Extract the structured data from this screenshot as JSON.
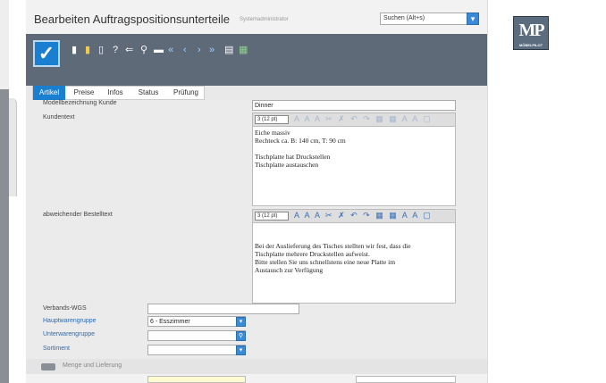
{
  "window": {
    "title": "Bearbeiten Auftragspositionsunterteile",
    "user": "Systemadministrator"
  },
  "search": {
    "placeholder": "Suchen (Alt+s)"
  },
  "logo": {
    "text": "MP",
    "tagline": "MÖBELPILOT"
  },
  "toolbar": {
    "icons": [
      "confirm-icon",
      "new-document-icon",
      "highlight-icon",
      "delete-icon",
      "help-icon",
      "back-icon",
      "search-icon",
      "print-icon",
      "first-icon",
      "previous-icon",
      "next-icon",
      "last-icon",
      "edit-document-icon",
      "table-icon"
    ],
    "glyphs": {
      "help": "?",
      "back": "⇐",
      "first": "«",
      "previous": "‹",
      "next": "›",
      "last": "»"
    }
  },
  "tabs": [
    {
      "label": "Artikel",
      "active": true
    },
    {
      "label": "Preise",
      "active": false
    },
    {
      "label": "Infos",
      "active": false
    },
    {
      "label": "Status",
      "active": false
    },
    {
      "label": "Prüfung",
      "active": false
    }
  ],
  "form": {
    "modell_label": "Modellbezeichnung Kunde",
    "modell_value": "Dinner",
    "kundentext_label": "Kundentext",
    "kundentext_font": "3 (12 pt)",
    "kundentext_lines": [
      "Eiche massiv",
      "Rechteck ca. B: 140 cm, T: 90 cm",
      "",
      "Tischplatte hat Druckstellen",
      "Tischplatte austauschen"
    ],
    "bestelltext_label": "abweichender Bestelltext",
    "bestelltext_font": "3 (12 pt)",
    "bestelltext_lines": [
      "Bei der Auslieferung des Tisches stellten wir fest, dass die",
      "Tischplatte mehrere Druckstellen aufweist.",
      "Bitte stellen Sie uns schnellstens eine neue Platte im",
      "Austausch zur Verfügung"
    ],
    "verbands_label": "Verbands-WGS",
    "verbands_value": "",
    "hauptwg_label": "Hauptwarengruppe",
    "hauptwg_value": "6 - Esszimmer",
    "unterwg_label": "Unterwarengruppe",
    "unterwg_value": "",
    "sortiment_label": "Sortiment",
    "sortiment_value": ""
  },
  "section": {
    "title": "Menge und Lieferung"
  },
  "colors": {
    "accent": "#1a7fd0",
    "toolbar": "#5e6a78",
    "link": "#2b6cb0"
  }
}
